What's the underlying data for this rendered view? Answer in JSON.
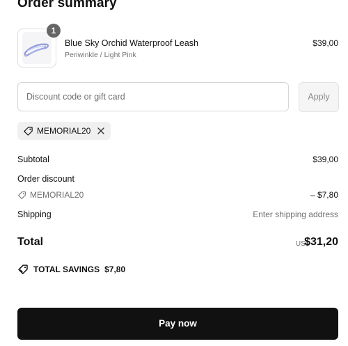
{
  "summary": {
    "title": "Order summary"
  },
  "line_item": {
    "quantity": "1",
    "name": "Blue Sky Orchid Waterproof Leash",
    "variant": "Periwinkle / Light Pink",
    "price": "$39,00",
    "image_icon": "leash-product-image"
  },
  "discount": {
    "placeholder": "Discount code or gift card",
    "value": "",
    "apply_label": "Apply",
    "applied_code": "MEMORIAL20"
  },
  "totals": {
    "subtotal_label": "Subtotal",
    "subtotal_value": "$39,00",
    "order_discount_label": "Order discount",
    "discount_code": "MEMORIAL20",
    "discount_value": "– $7,80",
    "shipping_label": "Shipping",
    "shipping_value": "Enter shipping address",
    "total_label": "Total",
    "currency": "USD",
    "total_value": "$31,20",
    "savings_label": "TOTAL SAVINGS",
    "savings_value": "$7,80"
  },
  "actions": {
    "pay_label": "Pay now"
  },
  "colors": {
    "text": "#111111",
    "muted": "#707070",
    "pay_button": "#111111",
    "badge": "#666666",
    "chip_bg": "#f0f0f0"
  }
}
